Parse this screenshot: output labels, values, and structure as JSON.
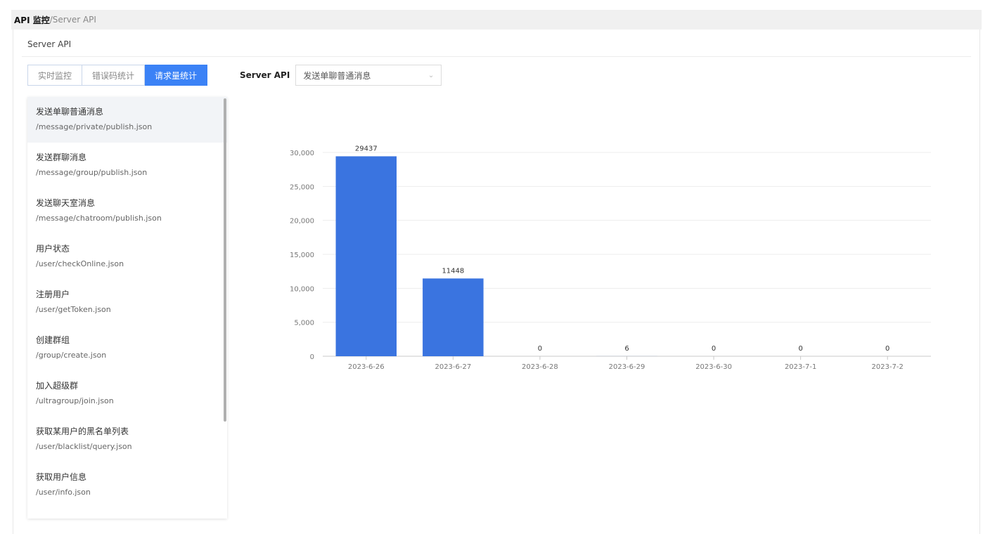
{
  "breadcrumb": {
    "root": "API 监控",
    "separator": "/",
    "current": "Server API"
  },
  "panel": {
    "title": "Server API"
  },
  "tabs": [
    {
      "label": "实时监控",
      "active": false
    },
    {
      "label": "错误码统计",
      "active": false
    },
    {
      "label": "请求量统计",
      "active": true
    }
  ],
  "filter": {
    "label": "Server API",
    "selected": "发送单聊普通消息"
  },
  "api_list": [
    {
      "name": "发送单聊普通消息",
      "path": "/message/private/publish.json",
      "active": true
    },
    {
      "name": "发送群聊消息",
      "path": "/message/group/publish.json",
      "active": false
    },
    {
      "name": "发送聊天室消息",
      "path": "/message/chatroom/publish.json",
      "active": false
    },
    {
      "name": "用户状态",
      "path": "/user/checkOnline.json",
      "active": false
    },
    {
      "name": "注册用户",
      "path": "/user/getToken.json",
      "active": false
    },
    {
      "name": "创建群组",
      "path": "/group/create.json",
      "active": false
    },
    {
      "name": "加入超级群",
      "path": "/ultragroup/join.json",
      "active": false
    },
    {
      "name": "获取某用户的黑名单列表",
      "path": "/user/blacklist/query.json",
      "active": false
    },
    {
      "name": "获取用户信息",
      "path": "/user/info.json",
      "active": false
    }
  ],
  "colors": {
    "accent": "#3b82f6",
    "bar": "#3a74e0"
  },
  "chart_data": {
    "type": "bar",
    "categories": [
      "2023-6-26",
      "2023-6-27",
      "2023-6-28",
      "2023-6-29",
      "2023-6-30",
      "2023-7-1",
      "2023-7-2"
    ],
    "values": [
      29437,
      11448,
      0,
      6,
      0,
      0,
      0
    ],
    "ylim": [
      0,
      30000
    ],
    "yticks": [
      0,
      5000,
      10000,
      15000,
      20000,
      25000,
      30000
    ],
    "ytick_labels": [
      "0",
      "5,000",
      "10,000",
      "15,000",
      "20,000",
      "25,000",
      "30,000"
    ],
    "grid": true
  }
}
